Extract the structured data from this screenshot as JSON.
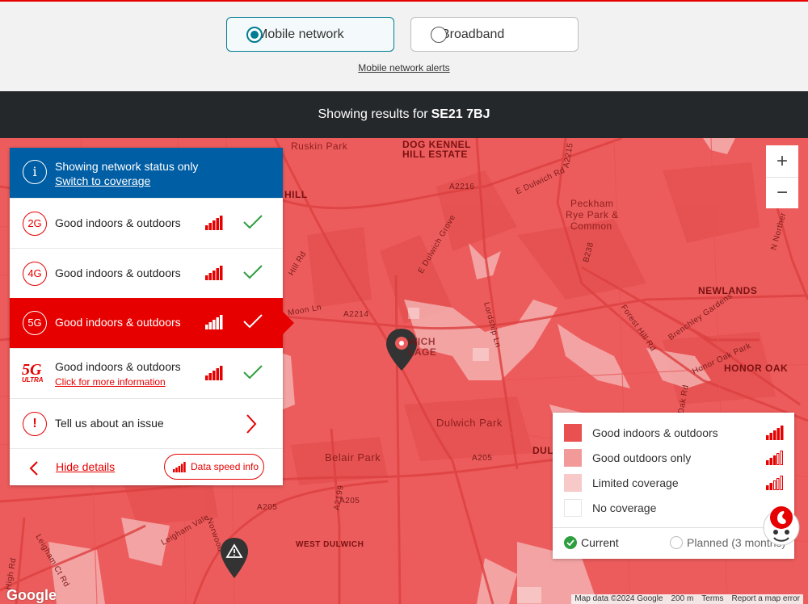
{
  "network_toggle": {
    "mobile_label": "Mobile network",
    "broadband_label": "Broadband",
    "selected": "Mobile network"
  },
  "alerts_link": "Mobile network alerts",
  "results": {
    "prefix": "Showing results for",
    "postcode": "SE21 7BJ"
  },
  "map": {
    "labels": [
      "Ruskin Park",
      "DOG KENNEL",
      "HILL ESTATE",
      "HILL",
      "Peckham",
      "Rye Park &",
      "Common",
      "NEWLANDS",
      "HONOR OAK",
      "Dulwich Park",
      "Belair Park",
      "WEST DULWICH",
      "DUL",
      "A2216",
      "A2214",
      "A205",
      "A205",
      "A205",
      "A2199",
      "A2215",
      "B238",
      "E Dulwich Rd",
      "E Dulwich Grove",
      "Lordship Ln",
      "Forest Hill Rd",
      "Brenchley Gardens",
      "Honor Oak Park",
      "Leigham Vale",
      "Norwood",
      "Leigham Ct Rd",
      "High Rd",
      "Moon Ln",
      "Hill Rd",
      "Dak Rd",
      "N Norther"
    ],
    "zoom_in": "+",
    "zoom_out": "−",
    "pin_label": "WICH",
    "pin_label2": "LAGE",
    "google_logo": "Google",
    "attribution": [
      "Map data ©2024 Google",
      "200 m",
      "Terms",
      "Report a map error"
    ]
  },
  "status_panel": {
    "info_title": "Showing network status only",
    "info_link": "Switch to coverage",
    "rows": [
      {
        "badge": "2G",
        "text": "Good indoors & outdoors"
      },
      {
        "badge": "4G",
        "text": "Good indoors & outdoors"
      },
      {
        "badge": "5G",
        "text": "Good indoors & outdoors"
      },
      {
        "badge": "5G ULTRA",
        "text": "Good indoors & outdoors",
        "more": "Click for more information"
      }
    ],
    "issue_text": "Tell us about an issue",
    "hide_details": "Hide details",
    "data_speed": "Data speed info",
    "ultra_big": "5G",
    "ultra_small": "ULTRA"
  },
  "legend": {
    "items": [
      {
        "label": "Good indoors & outdoors",
        "color": "#e95050"
      },
      {
        "label": "Good outdoors only",
        "color": "#f29a9a"
      },
      {
        "label": "Limited coverage",
        "color": "#f8c9c9"
      },
      {
        "label": "No coverage",
        "color": "#ffffff"
      }
    ],
    "current": "Current",
    "planned": "Planned (3 months)"
  },
  "colors": {
    "accent": "#e60000",
    "info_blue": "#005ea5",
    "map_red": "#ed5c5c",
    "dark_bar": "#25282b",
    "check_green": "#2e9e3e"
  }
}
